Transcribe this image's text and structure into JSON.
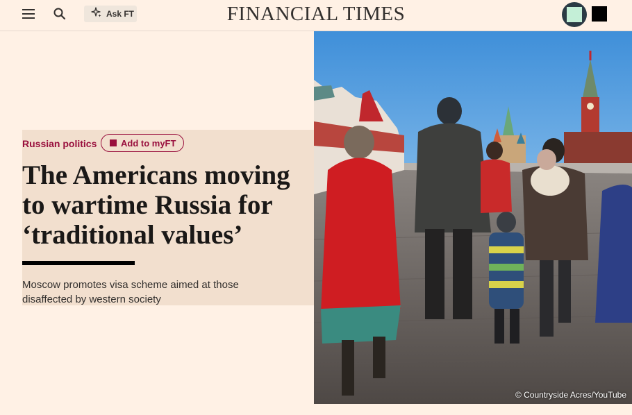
{
  "header": {
    "logo": "FINANCIAL TIMES",
    "ask_ft_label": "Ask FT",
    "menu_icon": "hamburger-menu-icon",
    "search_icon": "search-icon",
    "ask_ft_icon": "sparkle-icon"
  },
  "article": {
    "topic": "Russian politics",
    "myft_label": "Add to myFT",
    "headline": "The Americans moving to wartime Russia for ‘traditional values’",
    "standfirst": "Moscow promotes visa scheme aimed at those disaffected by western society"
  },
  "image": {
    "credit": "© Countryside Acres/YouTube"
  },
  "colors": {
    "page_background": "#FFF1E5",
    "panel_background": "#F2DFCE",
    "brand_claret": "#990F3D",
    "text": "#33302E"
  }
}
